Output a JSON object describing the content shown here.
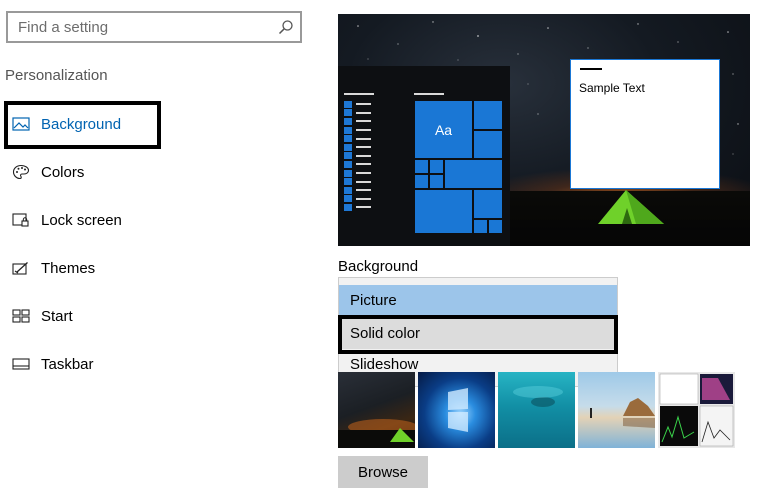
{
  "search": {
    "placeholder": "Find a setting",
    "icon": "search-icon"
  },
  "sidebar": {
    "section_title": "Personalization",
    "items": [
      {
        "label": "Background",
        "icon": "picture-icon",
        "active": true
      },
      {
        "label": "Colors",
        "icon": "palette-icon"
      },
      {
        "label": "Lock screen",
        "icon": "lock-screen-icon"
      },
      {
        "label": "Themes",
        "icon": "themes-icon"
      },
      {
        "label": "Start",
        "icon": "start-icon"
      },
      {
        "label": "Taskbar",
        "icon": "taskbar-icon"
      }
    ]
  },
  "preview": {
    "sample_text": "Sample Text",
    "tile_label": "Aa"
  },
  "background": {
    "label": "Background",
    "options": [
      "Picture",
      "Solid color",
      "Slideshow"
    ],
    "selected": "Picture",
    "hovered": "Solid color"
  },
  "thumbnails": [
    "night-tent-thumbnail",
    "windows-logo-thumbnail",
    "underwater-thumbnail",
    "beach-rocks-thumbnail",
    "screenshot-thumbnail"
  ],
  "browse_label": "Browse",
  "colors": {
    "accent": "#0063b1",
    "tile": "#1a77d5",
    "selected_option": "#9cc5ea",
    "hover_option": "#dcdcdc"
  }
}
